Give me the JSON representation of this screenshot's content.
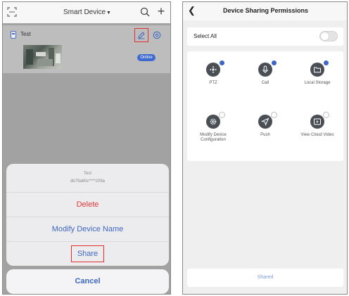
{
  "left": {
    "header": {
      "title": "Smart Device"
    },
    "device": {
      "name": "Test",
      "status_badge": "Online"
    },
    "sheet": {
      "device_name": "Test",
      "device_id": "db79a60c****209a",
      "delete_label": "Delete",
      "modify_label": "Modify Device Name",
      "share_label": "Share",
      "cancel_label": "Cancel"
    },
    "colors": {
      "highlight_box": "#e2302f",
      "accent": "#3e66c4",
      "delete": "#e53935"
    }
  },
  "right": {
    "header": {
      "title": "Device Sharing Permissions"
    },
    "select_all": {
      "label": "Select All",
      "enabled": false
    },
    "permissions": [
      {
        "label": "PTZ",
        "icon": "ptz-icon",
        "checked": true
      },
      {
        "label": "Call",
        "icon": "microphone-icon",
        "checked": true
      },
      {
        "label": "Local Storage",
        "icon": "folder-icon",
        "checked": true
      },
      {
        "label": "Modify Device Configuration",
        "icon": "gear-icon",
        "checked": false
      },
      {
        "label": "Push",
        "icon": "send-icon",
        "checked": false
      },
      {
        "label": "View Cloud Video",
        "icon": "cloud-video-icon",
        "checked": false
      }
    ],
    "shared_button": "Shared"
  }
}
